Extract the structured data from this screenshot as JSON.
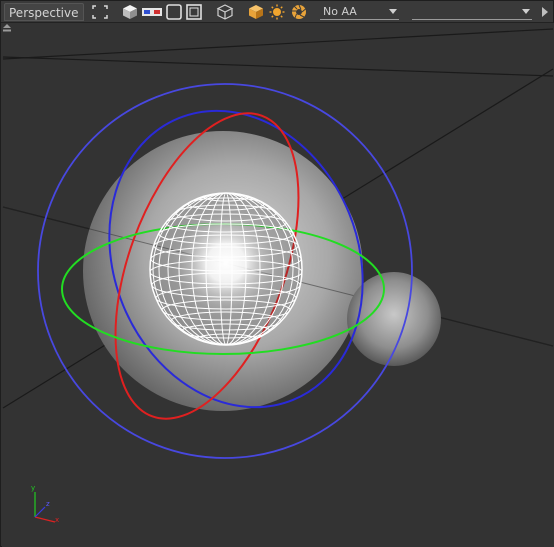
{
  "panel": {
    "title": "Perspective"
  },
  "toolbar": {
    "icons": [
      "fit-view-icon",
      "cube-icon",
      "stereo-glasses-icon",
      "square-icon",
      "frame-icon",
      "wire-cube-icon",
      "shaded-cube-icon",
      "sun-light-icon",
      "aperture-icon"
    ],
    "aa_dropdown": {
      "selected": "No AA"
    },
    "camera_dropdown": {
      "selected": ""
    }
  },
  "colors": {
    "accent_orange": "#e8a33a",
    "gizmo_x": "#e02020",
    "gizmo_y": "#22dd22",
    "gizmo_z": "#3a3ae0",
    "wireframe": "#ffffff"
  },
  "axis_indicator": {
    "x_label": "x",
    "y_label": "y",
    "z_label": "z"
  }
}
